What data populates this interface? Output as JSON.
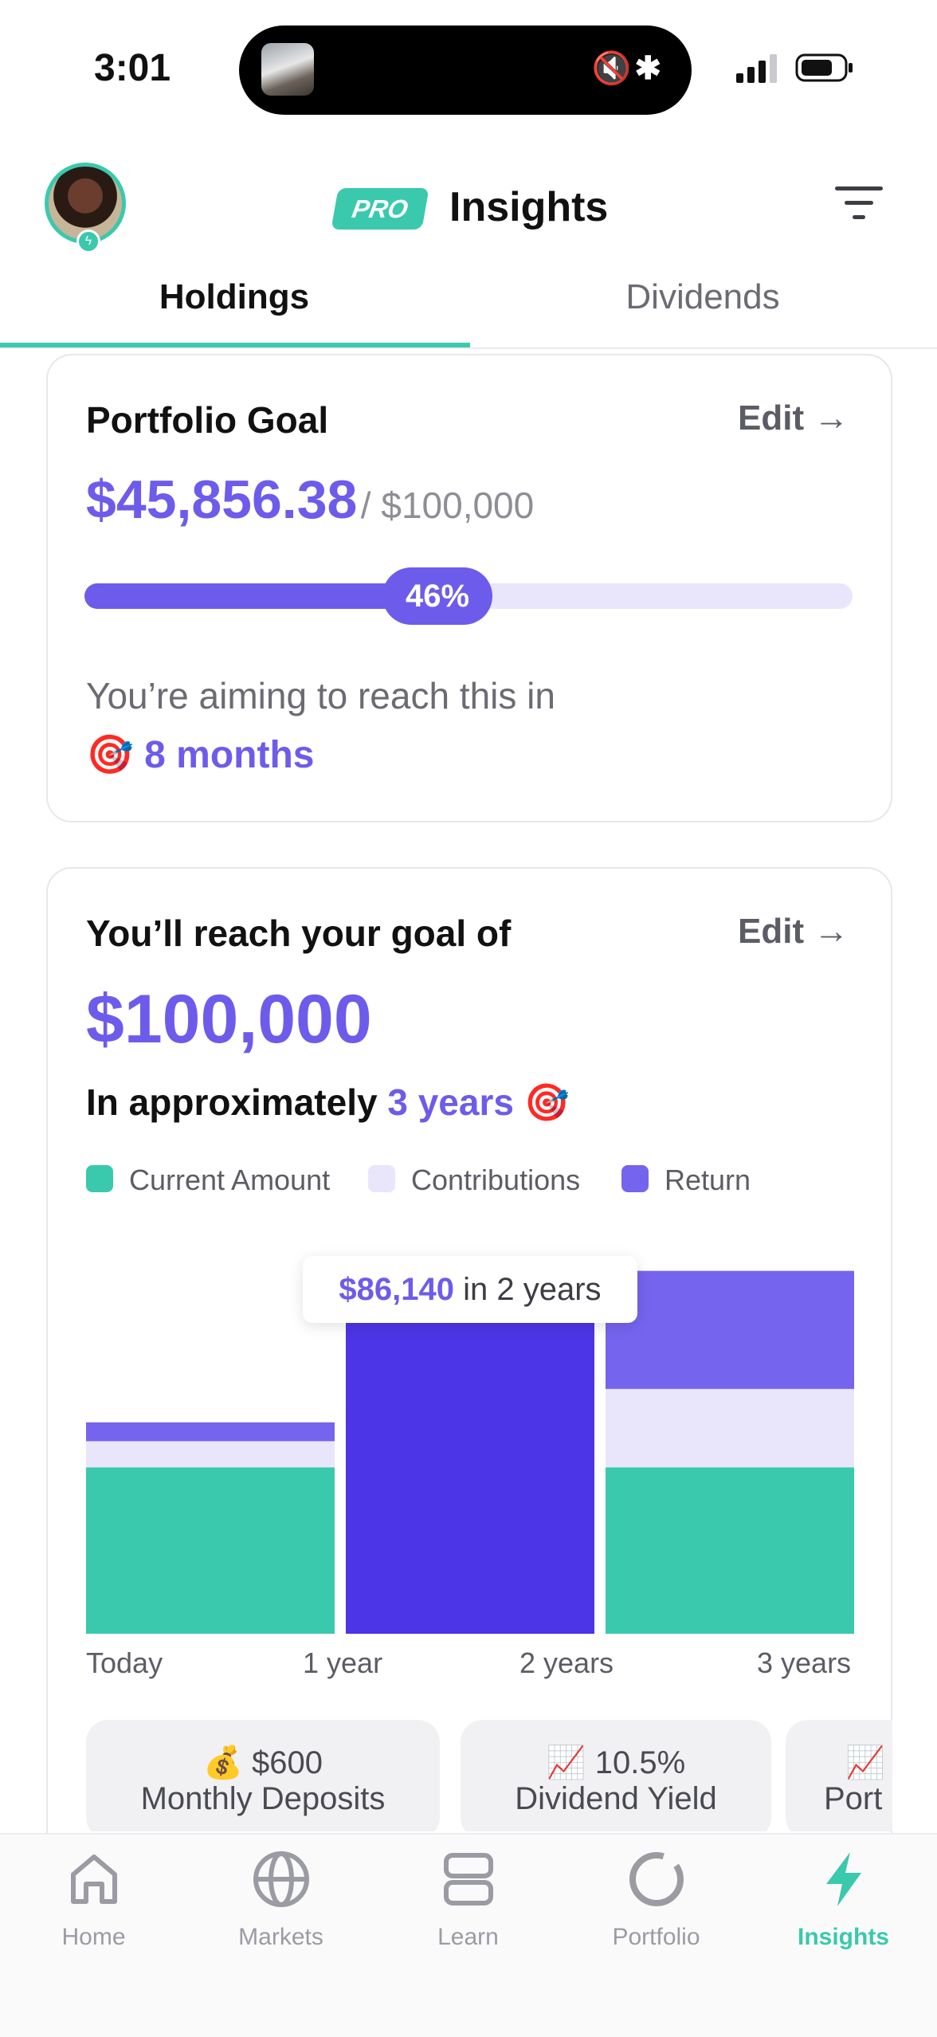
{
  "status_bar": {
    "time": "3:01"
  },
  "header": {
    "badge": "PRO",
    "title": "Insights"
  },
  "tabs": [
    {
      "label": "Holdings",
      "active": true
    },
    {
      "label": "Dividends",
      "active": false
    }
  ],
  "portfolio_goal": {
    "heading": "Portfolio Goal",
    "edit_label": "Edit →",
    "current_amount": "$45,856.38",
    "target_amount": "/ $100,000",
    "progress_percent": 46,
    "progress_label": "46%",
    "aim_text": "You’re aiming to reach this in",
    "aim_emoji": "🎯",
    "aim_value": "8 months"
  },
  "projection": {
    "heading": "You’ll reach your goal of",
    "edit_label": "Edit →",
    "goal_amount": "$100,000",
    "approx_prefix": "In approximately",
    "approx_value": "3 years",
    "approx_emoji": "🎯",
    "legend": [
      {
        "label": "Current Amount",
        "color": "#3ac9ad"
      },
      {
        "label": "Contributions",
        "color": "#e9e6fb"
      },
      {
        "label": "Return",
        "color": "#7564ee"
      }
    ],
    "tooltip": {
      "value": "$86,140",
      "suffix": "in 2 years"
    },
    "chips": [
      {
        "emoji": "💰",
        "value": "$600",
        "label": "Monthly Deposits"
      },
      {
        "emoji": "📈",
        "value": "10.5%",
        "label": "Dividend Yield"
      },
      {
        "emoji": "📈",
        "value": "",
        "label": "Port"
      }
    ]
  },
  "chart_data": {
    "type": "bar",
    "stacked": true,
    "categories": [
      "Today",
      "1 year",
      "2 years",
      "3 years"
    ],
    "bar_positions": [
      0,
      1.5,
      3
    ],
    "series": [
      {
        "name": "Current Amount",
        "color": "#3ac9ad",
        "values": [
          45856,
          0,
          45856
        ]
      },
      {
        "name": "Contributions",
        "color": "#e9e6fb",
        "values": [
          7200,
          0,
          21600
        ]
      },
      {
        "name": "Return",
        "color": "#7564ee",
        "values": [
          5200,
          86140,
          32544
        ]
      }
    ],
    "highlight": {
      "bar": 1,
      "color": "#4b35e6",
      "value": 86140,
      "label": "$86,140 in 2 years"
    },
    "ylim": [
      0,
      112000
    ]
  },
  "nav": [
    {
      "label": "Home",
      "icon": "home-icon",
      "active": false
    },
    {
      "label": "Markets",
      "icon": "globe-icon",
      "active": false
    },
    {
      "label": "Learn",
      "icon": "learn-icon",
      "active": false
    },
    {
      "label": "Portfolio",
      "icon": "portfolio-icon",
      "active": false
    },
    {
      "label": "Insights",
      "icon": "bolt-icon",
      "active": true
    }
  ]
}
